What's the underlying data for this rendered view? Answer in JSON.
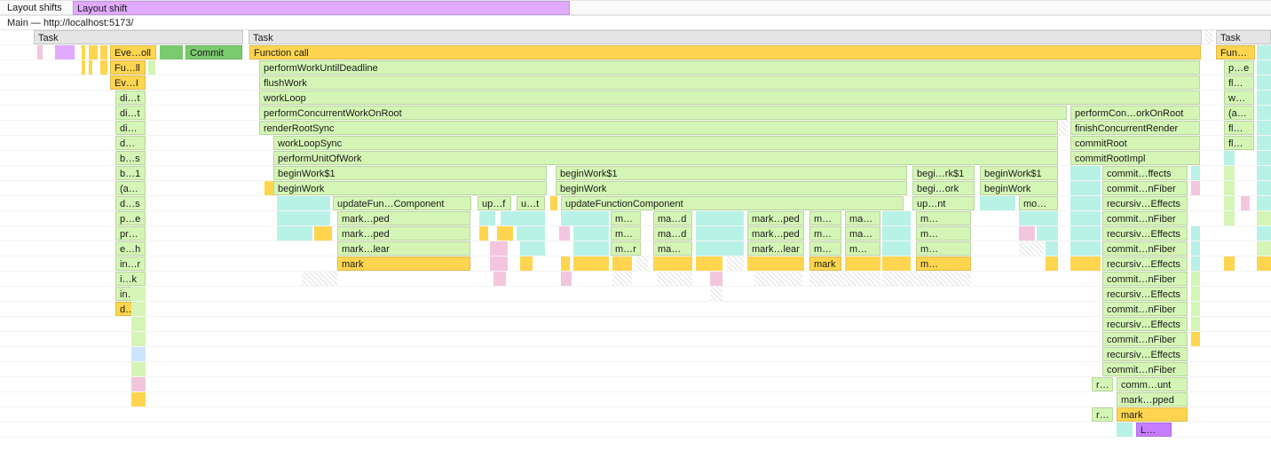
{
  "layoutShifts": {
    "trackLabel": "Layout shifts",
    "barLabel": "Layout shift"
  },
  "main": {
    "trackLabel": "Main — http://localhost:5173/"
  },
  "task": "Task",
  "callstack": {
    "functionCall": "Function call",
    "commit": "Commit",
    "eventScroll": "Eve…oll",
    "fuII": "Fu…ll",
    "evI": "Ev…I",
    "diT": "di…t",
    "diY": "di…y",
    "d": "d…",
    "bS": "b…s",
    "b1": "b…1",
    "aParen": "(a…)",
    "dS": "d…s",
    "pE": "p…e",
    "prR": "pr…r",
    "eH": "e…h",
    "inR": "in…r",
    "iK": "i…k",
    "inV": "in…v",
    "dT": "d…t"
  },
  "stack": {
    "performWorkUntilDeadline": "performWorkUntilDeadline",
    "flushWork": "flushWork",
    "workLoop": "workLoop",
    "performConcurrentWorkOnRoot": "performConcurrentWorkOnRoot",
    "renderRootSync": "renderRootSync",
    "workLoopSync": "workLoopSync",
    "performUnitOfWork": "performUnitOfWork",
    "beginWork1": "beginWork$1",
    "beginWork": "beginWork",
    "updateFunctionComponent": "updateFun…Component",
    "updateFunctionComponentFull": "updateFunctionComponent",
    "markPed": "mark…ped",
    "markLear": "mark…lear",
    "mark": "mark",
    "upF": "up…f",
    "uT": "u…t",
    "upNt": "up…nt",
    "moNt": "mo…nt",
    "begiRk1": "begi…rk$1",
    "begiOrk": "begi…ork",
    "maShort": "m…",
    "maD": "ma…d",
    "maR": "m…r",
    "maAr": "ma…ar",
    "mD": "m…d",
    "mArrd": "m…d"
  },
  "right": {
    "performConOrkOnRoot": "performCon…orkOnRoot",
    "finishConcurrentRender": "finishConcurrentRender",
    "commitRoot": "commitRoot",
    "commitRootImpl": "commitRootImpl",
    "commitFffects": "commit…ffects",
    "commitNFiber": "commit…nFiber",
    "recursivEffects": "recursiv…Effects",
    "rShort": "r…",
    "commUnt": "comm…unt",
    "markPped": "mark…pped",
    "L": "L…"
  },
  "col3": {
    "funII": "Fun…ll",
    "pE": "p…e",
    "flRk": "fl…rk",
    "wP": "w…p",
    "aParen": "(a…)",
    "flTs": "fl…ts",
    "flPl": "fl…pl"
  }
}
